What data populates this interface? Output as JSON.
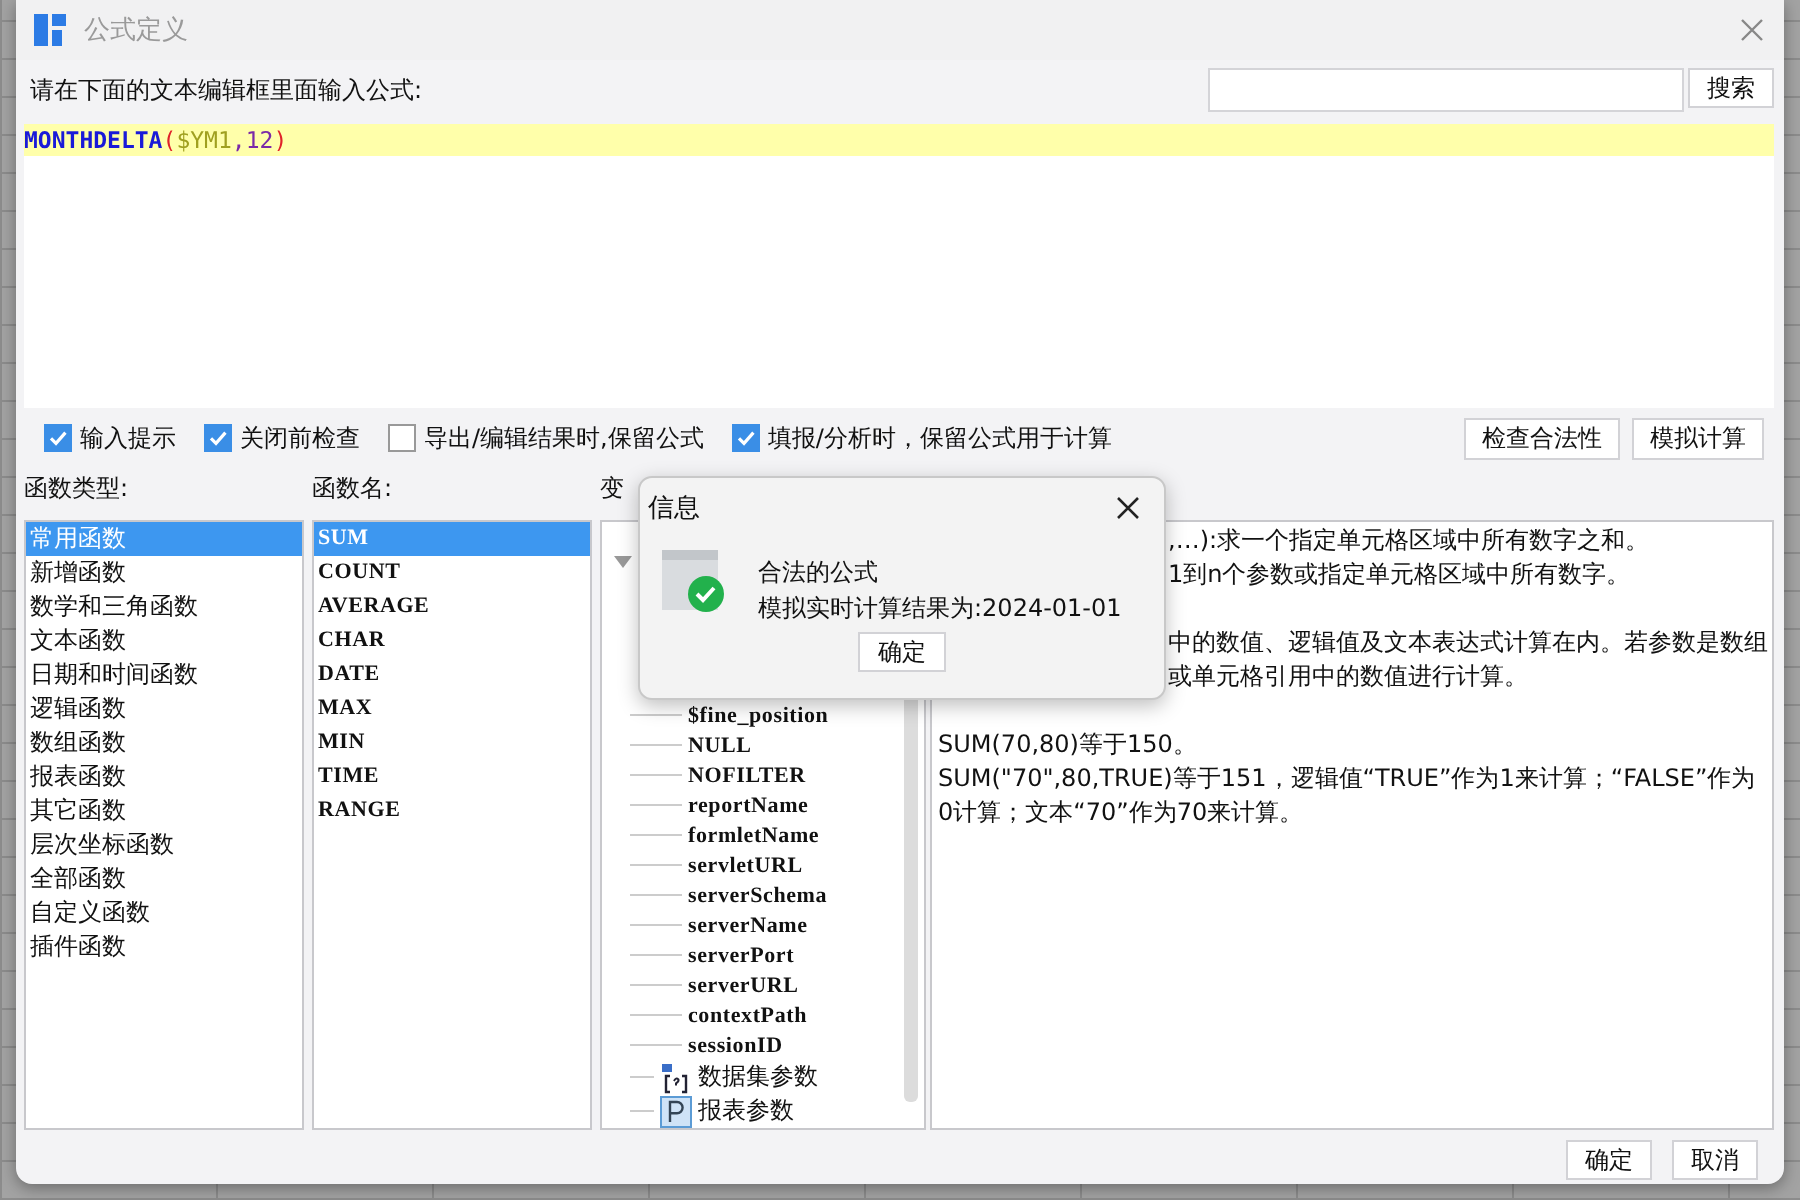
{
  "window": {
    "title": "公式定义"
  },
  "prompt": "请在下面的文本编辑框里面输入公式:",
  "search": {
    "button": "搜索"
  },
  "formula": [
    {
      "kind": "function",
      "text": "MONTHDELTA"
    },
    {
      "kind": "paren",
      "text": "("
    },
    {
      "kind": "variable",
      "text": "$YM1"
    },
    {
      "kind": "comma",
      "text": ","
    },
    {
      "kind": "number",
      "text": "12"
    },
    {
      "kind": "paren",
      "text": ")"
    }
  ],
  "options": [
    {
      "label": "输入提示",
      "checked": true
    },
    {
      "label": "关闭前检查",
      "checked": true
    },
    {
      "label": "导出/编辑结果时,保留公式",
      "checked": false
    },
    {
      "label": "填报/分析时，保留公式用于计算",
      "checked": true
    }
  ],
  "tool_buttons": [
    "检查合法性",
    "模拟计算"
  ],
  "function_types": {
    "label": "函数类型:",
    "items": [
      {
        "label": "常用函数",
        "selected": true
      },
      {
        "label": "新增函数",
        "selected": false
      },
      {
        "label": "数学和三角函数",
        "selected": false
      },
      {
        "label": "文本函数",
        "selected": false
      },
      {
        "label": "日期和时间函数",
        "selected": false
      },
      {
        "label": "逻辑函数",
        "selected": false
      },
      {
        "label": "数组函数",
        "selected": false
      },
      {
        "label": "报表函数",
        "selected": false
      },
      {
        "label": "其它函数",
        "selected": false
      },
      {
        "label": "层次坐标函数",
        "selected": false
      },
      {
        "label": "全部函数",
        "selected": false
      },
      {
        "label": "自定义函数",
        "selected": false
      },
      {
        "label": "插件函数",
        "selected": false
      }
    ]
  },
  "function_names": {
    "label": "函数名:",
    "items": [
      {
        "label": "SUM",
        "selected": true
      },
      {
        "label": "COUNT",
        "selected": false
      },
      {
        "label": "AVERAGE",
        "selected": false
      },
      {
        "label": "CHAR",
        "selected": false
      },
      {
        "label": "DATE",
        "selected": false
      },
      {
        "label": "MAX",
        "selected": false
      },
      {
        "label": "MIN",
        "selected": false
      },
      {
        "label": "TIME",
        "selected": false
      },
      {
        "label": "RANGE",
        "selected": false
      }
    ]
  },
  "variable_tree": {
    "label": "变",
    "nodes": [
      {
        "expanded": true,
        "children": [
          {
            "label": "$fine_position"
          },
          {
            "label": "NULL"
          },
          {
            "label": "NOFILTER"
          },
          {
            "label": "reportName"
          },
          {
            "label": "formletName"
          },
          {
            "label": "servletURL"
          },
          {
            "label": "serverSchema"
          },
          {
            "label": "serverName"
          },
          {
            "label": "serverPort"
          },
          {
            "label": "serverURL"
          },
          {
            "label": "contextPath"
          },
          {
            "label": "sessionID"
          }
        ]
      },
      {
        "kind": "dataset",
        "label": "数据集参数"
      },
      {
        "kind": "report",
        "label": "报表参数"
      }
    ]
  },
  "description": [
    {
      "kind": "partial",
      "text": ",…):求一个指定单元格区域中所有数字之和。"
    },
    {
      "kind": "partial",
      "text": "1到n个参数或指定单元格区域中所有数字。"
    },
    {
      "kind": "blank"
    },
    {
      "kind": "partial",
      "text": "中的数值、逻辑值及文本表达式计算在内。若参数是数组"
    },
    {
      "kind": "partial",
      "text": "或单元格引用中的数值进行计算。"
    },
    {
      "kind": "blank"
    },
    {
      "kind": "full",
      "text": "SUM(70,80)等于150。"
    },
    {
      "kind": "full",
      "text": "SUM(\"70\",80,TRUE)等于151，逻辑值“TRUE”作为1来计算；“FALSE”作为0计算；文本“70”作为70来计算。"
    }
  ],
  "footer_buttons": [
    "确定",
    "取消"
  ],
  "message": {
    "title": "信息",
    "lines": [
      "合法的公式",
      "模拟实时计算结果为:2024-01-01"
    ],
    "button": "确定"
  }
}
